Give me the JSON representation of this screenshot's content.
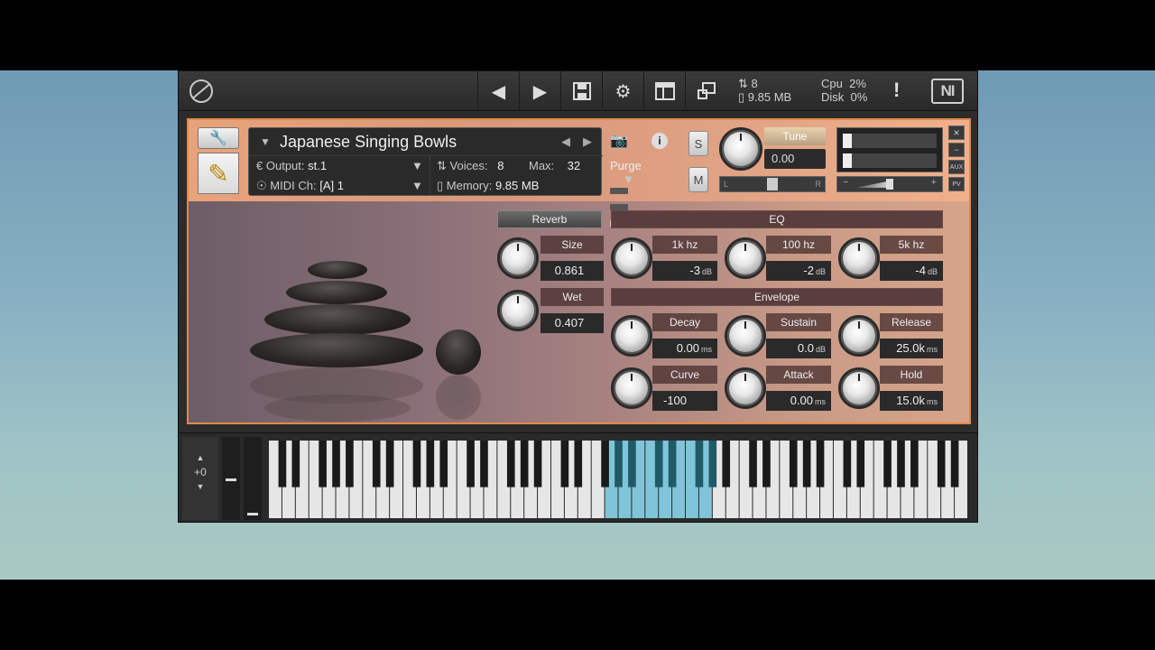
{
  "toolbar": {
    "voices_icon_count": "8",
    "memory_total": "9.85 MB",
    "cpu_label": "Cpu",
    "cpu_value": "2%",
    "disk_label": "Disk",
    "disk_value": "0%",
    "ni_logo": "NI"
  },
  "instrument": {
    "name": "Japanese Singing Bowls",
    "output_label": "Output:",
    "output_value": "st.1",
    "voices_label": "Voices:",
    "voices_value": "8",
    "max_label": "Max:",
    "max_value": "32",
    "purge_label": "Purge",
    "midi_label": "MIDI Ch:",
    "midi_value": "[A]  1",
    "memory_label": "Memory:",
    "memory_value": "9.85 MB",
    "solo_label": "S",
    "mute_label": "M",
    "tune_label": "Tune",
    "tune_value": "0.00",
    "pan_left": "L",
    "pan_right": "R",
    "aux_label": "AUX",
    "pv_label": "PV"
  },
  "reverb": {
    "header": "Reverb",
    "size_label": "Size",
    "size_value": "0.861",
    "wet_label": "Wet",
    "wet_value": "0.407"
  },
  "eq": {
    "header": "EQ",
    "bands": [
      {
        "label": "1k hz",
        "value": "-3",
        "unit": "dB"
      },
      {
        "label": "100 hz",
        "value": "-2",
        "unit": "dB"
      },
      {
        "label": "5k hz",
        "value": "-4",
        "unit": "dB"
      }
    ]
  },
  "envelope": {
    "header": "Envelope",
    "decay_label": "Decay",
    "decay_value": "0.00",
    "decay_unit": "ms",
    "sustain_label": "Sustain",
    "sustain_value": "0.0",
    "sustain_unit": "dB",
    "release_label": "Release",
    "release_value": "25.0k",
    "release_unit": "ms",
    "curve_label": "Curve",
    "curve_value": "-100",
    "attack_label": "Attack",
    "attack_value": "0.00",
    "attack_unit": "ms",
    "hold_label": "Hold",
    "hold_value": "15.0k",
    "hold_unit": "ms"
  },
  "keyboard": {
    "octave_value": "+0",
    "white_key_count": 52,
    "highlight_start": 25,
    "highlight_end": 33,
    "highlight_color": "#7fc4d8"
  },
  "colors": {
    "accent_border": "#e08a4a"
  }
}
